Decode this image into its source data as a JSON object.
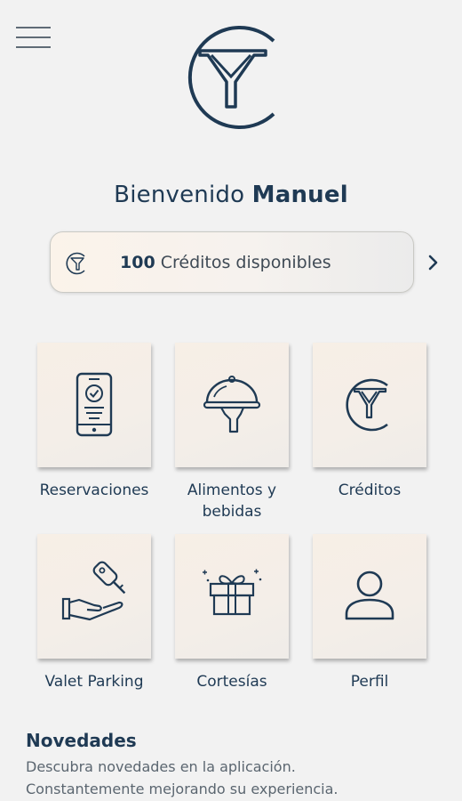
{
  "header": {
    "menu_icon": "hamburger-menu-icon",
    "logo_icon": "brand-logo-icon"
  },
  "welcome": {
    "greeting": "Bienvenido",
    "name": "Manuel"
  },
  "credits": {
    "amount": "100",
    "label": "Créditos disponibles",
    "icon": "brand-mini-logo-icon",
    "chevron": "chevron-right-icon"
  },
  "grid": {
    "reservations": "Reservaciones",
    "food_line1": "Alimentos y",
    "food_line2": "bebidas",
    "credits": "Créditos",
    "valet": "Valet Parking",
    "courtesies": "Cortesías",
    "profile": "Perfil"
  },
  "news": {
    "title": "Novedades",
    "line1": "Descubra novedades en la aplicación.",
    "line2": "Constantemente mejorando su experiencia."
  },
  "colors": {
    "primary": "#1f3a54",
    "background": "#f2f2f2",
    "tile": "#f6efe7"
  }
}
